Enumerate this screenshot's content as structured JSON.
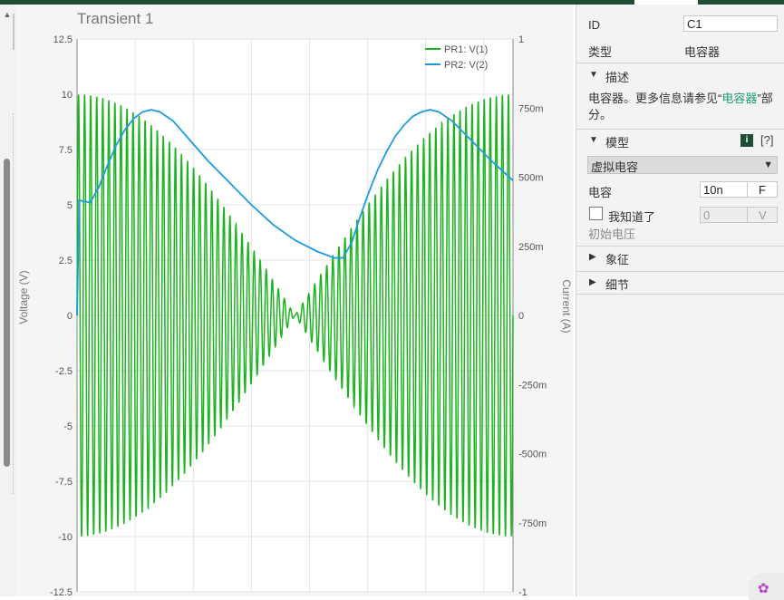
{
  "chart_data": {
    "type": "line",
    "title": "Transient 1",
    "xlabel": "",
    "ylabel": "Voltage (V)",
    "y2label": "Current (A)",
    "ylim": [
      -12.5,
      12.5
    ],
    "y2lim": [
      -1,
      1
    ],
    "y_ticks": [
      "12.5",
      "10",
      "7.5",
      "5",
      "2.5",
      "0",
      "-2.5",
      "-5",
      "-7.5",
      "-10",
      "-12.5"
    ],
    "y2_ticks": [
      "1",
      "750m",
      "500m",
      "250m",
      "0",
      "-250m",
      "-500m",
      "-750m",
      "-1"
    ],
    "grid": true,
    "legend_position": "top-right",
    "x_range": [
      0,
      1
    ],
    "series": [
      {
        "name": "PR1: V(1)",
        "axis": "left",
        "color": "#1db320",
        "description_values": {
          "peak_amplitude": 10,
          "envelope_zero_at_x": 0.5,
          "cycles": 72
        }
      },
      {
        "name": "PR2: V(2)",
        "axis": "left",
        "color": "#1e9be0",
        "points": [
          [
            0,
            0
          ],
          [
            0.005,
            5.2
          ],
          [
            0.03,
            5.1
          ],
          [
            0.05,
            5.8
          ],
          [
            0.07,
            6.8
          ],
          [
            0.09,
            7.7
          ],
          [
            0.11,
            8.4
          ],
          [
            0.13,
            8.9
          ],
          [
            0.15,
            9.2
          ],
          [
            0.17,
            9.3
          ],
          [
            0.19,
            9.2
          ],
          [
            0.22,
            8.8
          ],
          [
            0.26,
            7.9
          ],
          [
            0.3,
            7.0
          ],
          [
            0.35,
            6.0
          ],
          [
            0.4,
            5.0
          ],
          [
            0.45,
            4.1
          ],
          [
            0.5,
            3.4
          ],
          [
            0.55,
            2.9
          ],
          [
            0.59,
            2.6
          ],
          [
            0.61,
            2.6
          ],
          [
            0.63,
            3.3
          ],
          [
            0.65,
            4.5
          ],
          [
            0.67,
            5.6
          ],
          [
            0.69,
            6.6
          ],
          [
            0.71,
            7.4
          ],
          [
            0.73,
            8.1
          ],
          [
            0.75,
            8.6
          ],
          [
            0.77,
            9.0
          ],
          [
            0.79,
            9.2
          ],
          [
            0.81,
            9.3
          ],
          [
            0.83,
            9.2
          ],
          [
            0.86,
            8.8
          ],
          [
            0.9,
            8.0
          ],
          [
            0.95,
            7.0
          ],
          [
            1.0,
            6.1
          ]
        ]
      }
    ]
  },
  "sidebar": {
    "id_label": "ID",
    "id_value": "C1",
    "type_label": "类型",
    "type_value": "电容器",
    "description_header": "描述",
    "description_text_pre": "电容器。更多信息请参见“",
    "description_link": "电容器",
    "description_text_post": "”部分。",
    "model_header": "模型",
    "info_badge": "i",
    "help_link": "[?]",
    "model_select_value": "虚拟电容",
    "capacitance_label": "电容",
    "capacitance_value": "10n",
    "capacitance_unit": "F",
    "ack_label": "我知道了",
    "initial_voltage_value": "0",
    "initial_voltage_unit": "V",
    "initial_voltage_label": "初始电压",
    "symbol_header": "象征",
    "details_header": "细节"
  },
  "colors": {
    "accent": "#1f4d36",
    "link": "#1a9c6f",
    "green_trace": "#1db320",
    "blue_trace": "#1e9be0"
  }
}
